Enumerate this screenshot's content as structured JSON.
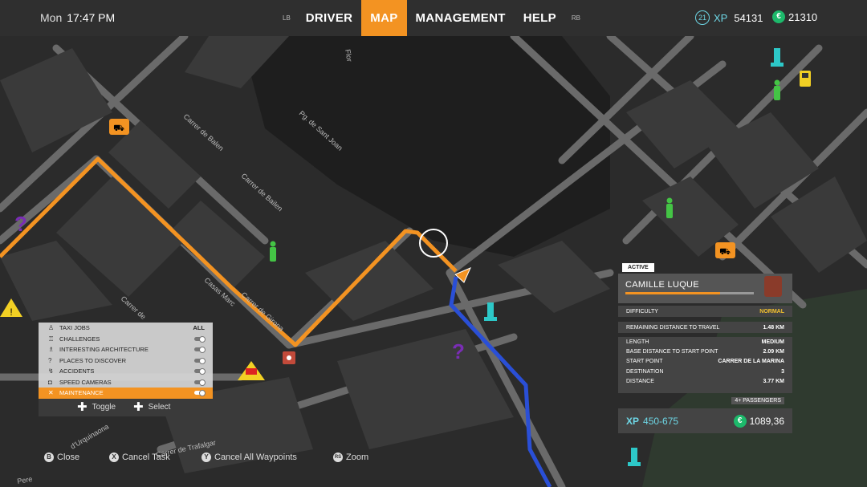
{
  "header": {
    "day": "Mon",
    "time": "17:47 PM",
    "bumper_left": "LB",
    "bumper_right": "RB",
    "tabs": [
      {
        "label": "DRIVER",
        "active": false
      },
      {
        "label": "MAP",
        "active": true
      },
      {
        "label": "MANAGEMENT",
        "active": false
      },
      {
        "label": "HELP",
        "active": false
      }
    ],
    "level": "21",
    "xp_label": "XP",
    "xp_value": "54131",
    "money_symbol": "€",
    "money_value": "21310",
    "accent": "#f39322"
  },
  "map_labels": {
    "streets": [
      "Carrer de Balen",
      "Pg. de Sant Joan",
      "Carrer de Bailen",
      "Carrer de Girona",
      "Carrer de Trafalgar",
      "d'Urquinaona",
      "Pere",
      "Flor",
      "Casas Marc",
      "Carrer de"
    ]
  },
  "legend": {
    "items": [
      {
        "label": "TAXI JOBS",
        "icon": "person-icon",
        "value": "ALL"
      },
      {
        "label": "CHALLENGES",
        "icon": "trophy-icon"
      },
      {
        "label": "INTERESTING ARCHITECTURE",
        "icon": "monument-icon"
      },
      {
        "label": "PLACES TO DISCOVER",
        "icon": "question-icon"
      },
      {
        "label": "ACCIDENTS",
        "icon": "accident-icon"
      },
      {
        "label": "SPEED CAMERAS",
        "icon": "camera-icon"
      },
      {
        "label": "MAINTENANCE",
        "icon": "wrench-icon",
        "selected": true
      }
    ],
    "toggle_label": "Toggle",
    "select_label": "Select"
  },
  "bottom_hints": [
    {
      "button": "B",
      "label": "Close"
    },
    {
      "button": "X",
      "label": "Cancel Task"
    },
    {
      "button": "Y",
      "label": "Cancel All Waypoints"
    },
    {
      "button": "RS",
      "label": "Zoom"
    }
  ],
  "job": {
    "status": "ACTIVE",
    "name": "CAMILLE LUQUE",
    "progress": 0.74,
    "difficulty_label": "DIFFICULTY",
    "difficulty_value": "NORMAL",
    "remaining_label": "REMAINING DISTANCE TO TRAVEL",
    "remaining_value": "1.48 KM",
    "details": [
      {
        "label": "LENGTH",
        "value": "MEDIUM"
      },
      {
        "label": "BASE DISTANCE TO START POINT",
        "value": "2.09 KM"
      },
      {
        "label": "START POINT",
        "value": "CARRER DE LA MARINA"
      },
      {
        "label": "DESTINATION",
        "value": "3"
      },
      {
        "label": "DISTANCE",
        "value": "3.77 KM"
      }
    ],
    "passengers": "4+ PASSENGERS",
    "xp_label": "XP",
    "xp_range": "450-675",
    "money_symbol": "€",
    "reward": "1089,36"
  }
}
